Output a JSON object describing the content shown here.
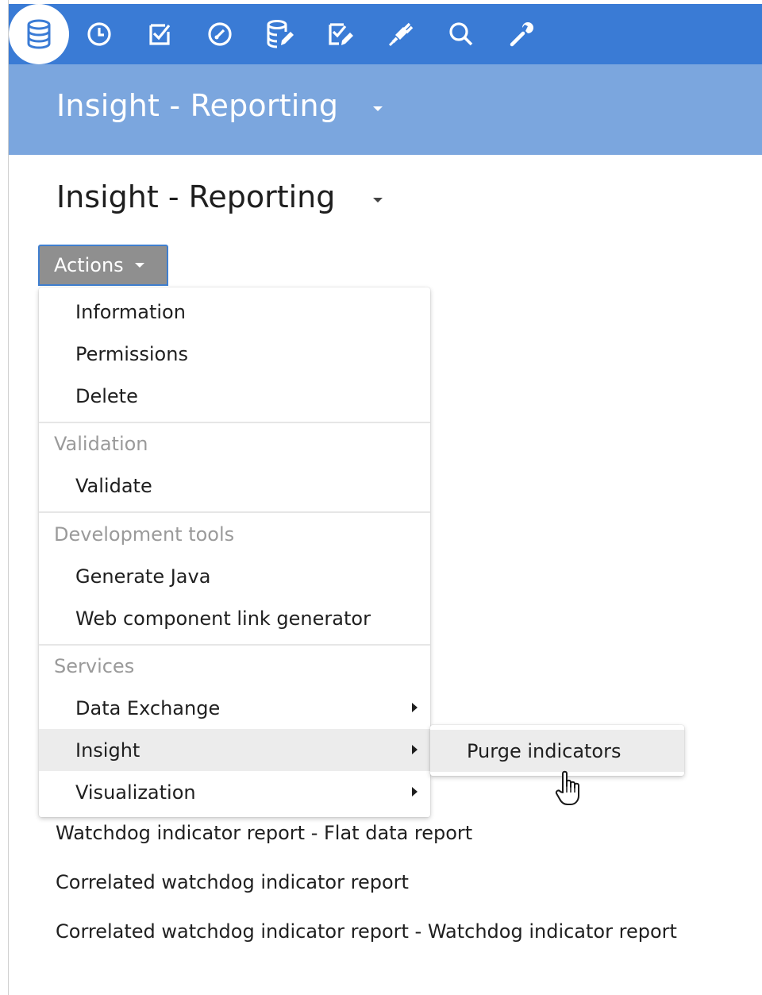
{
  "toolbar": {
    "icons": [
      "database-icon",
      "clock-icon",
      "checkbox-icon",
      "gauge-icon",
      "database-edit-icon",
      "checklist-edit-icon",
      "plug-icon",
      "search-icon",
      "wrench-icon"
    ],
    "accent_color": "#3a7bd5",
    "band_color": "#7ba6de"
  },
  "header": {
    "title": "Insight - Reporting"
  },
  "page": {
    "title": "Insight - Reporting"
  },
  "actions": {
    "label": "Actions"
  },
  "menu": {
    "information": "Information",
    "permissions": "Permissions",
    "delete": "Delete",
    "validation_header": "Validation",
    "validate": "Validate",
    "devtools_header": "Development tools",
    "generate_java": "Generate Java",
    "web_component": "Web component link generator",
    "services_header": "Services",
    "data_exchange": "Data Exchange",
    "insight": "Insight",
    "visualization": "Visualization"
  },
  "submenu": {
    "purge_indicators": "Purge indicators"
  },
  "reports": [
    "Watchdog indicator report - Flat data report",
    "Correlated watchdog indicator report",
    "Correlated watchdog indicator report - Watchdog indicator report"
  ]
}
